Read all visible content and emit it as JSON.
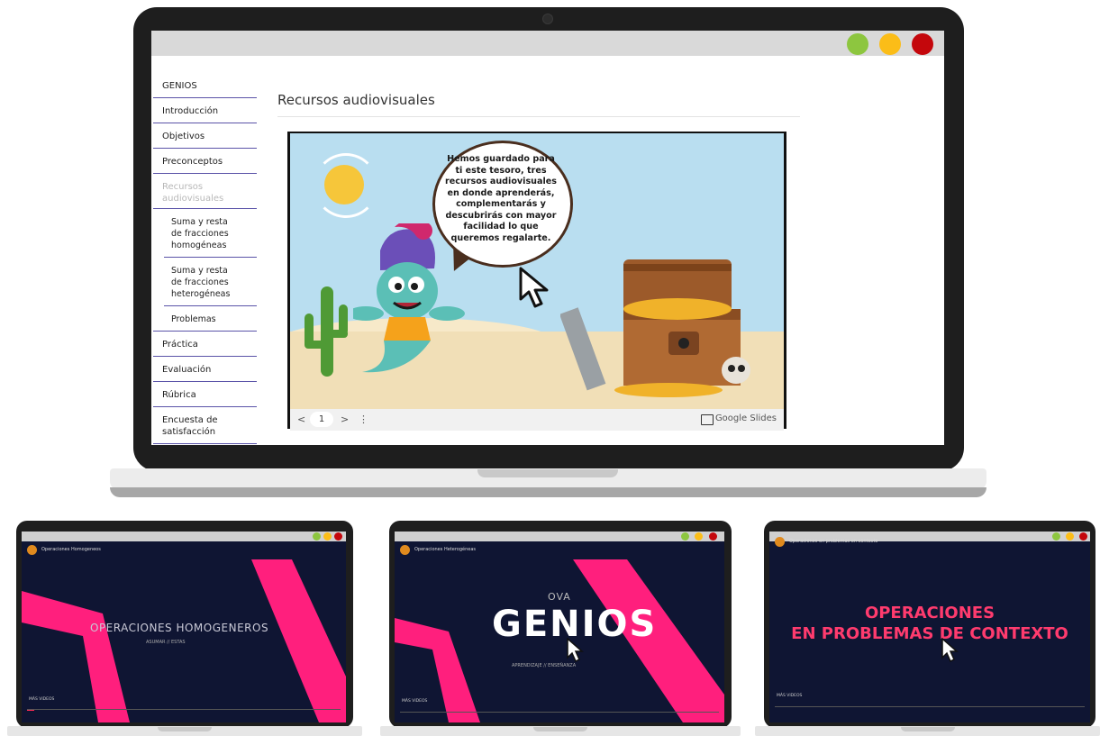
{
  "window": {
    "dots": {
      "green": "#8dc63f",
      "yellow": "#fbbd18",
      "red": "#c4070c"
    }
  },
  "sidebar": {
    "items": [
      {
        "label": "GENIOS",
        "state": "normal"
      },
      {
        "label": "Introducción",
        "state": "normal"
      },
      {
        "label": "Objetivos",
        "state": "normal"
      },
      {
        "label": "Preconceptos",
        "state": "normal"
      },
      {
        "label": "Recursos audiovisuales",
        "state": "active"
      },
      {
        "label": "Suma y resta de fracciones homogéneas",
        "state": "sub"
      },
      {
        "label": "Suma y resta de fracciones heterogéneas",
        "state": "sub"
      },
      {
        "label": "Problemas",
        "state": "sub"
      },
      {
        "label": "Práctica",
        "state": "normal"
      },
      {
        "label": "Evaluación",
        "state": "normal"
      },
      {
        "label": "Rúbrica",
        "state": "normal"
      },
      {
        "label": "Encuesta de satisfacción",
        "state": "normal"
      }
    ]
  },
  "main": {
    "title": "Recursos audiovisuales",
    "slide": {
      "bubble_text": "Hemos guardado para ti este tesoro, tres recursos audiovisuales en donde aprenderás, complementarás y descubrirás con mayor facilidad lo que queremos regalarte."
    },
    "slides_bar": {
      "prev": "<",
      "page": "1",
      "next": ">",
      "menu": "⋮",
      "brand": "Google Slides"
    }
  },
  "videos": [
    {
      "channel_title": "Operaciones Homogeneos",
      "headline": "OPERACIONES HOMOGENEROS",
      "sub": "ASUMAR  //  ESTAS",
      "more": "MÁS VIDEOS",
      "accent": "#ff1f7d"
    },
    {
      "channel_title": "Operaciones Heterogéneas",
      "pre": "OVA",
      "headline": "GENIOS",
      "sub": "APRENDIZAJE  //  ENSEÑANZA",
      "more": "MÁS VIDEOS",
      "accent": "#ff1f7d"
    },
    {
      "channel_title": "Operaciones en problemas en contexto",
      "headline_line1": "OPERACIONES",
      "headline_line2": "EN PROBLEMAS DE CONTEXTO",
      "more": "MÁS VIDEOS",
      "accent": "#ff3b6e"
    }
  ]
}
